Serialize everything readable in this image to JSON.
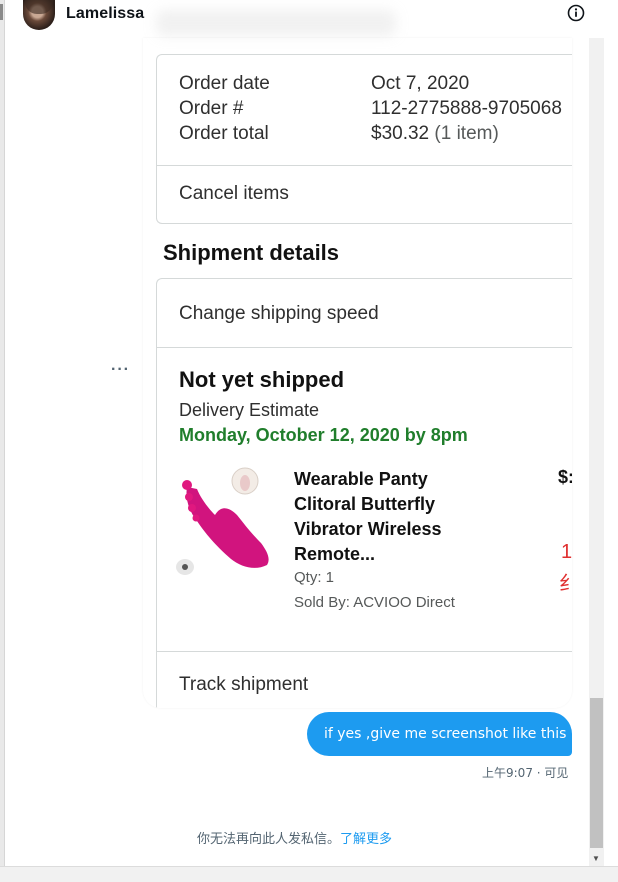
{
  "header": {
    "user_name": "Lamelissa",
    "info_icon": "info-icon"
  },
  "order_card": {
    "order_date_label": "Order date",
    "order_date_value": "Oct 7, 2020",
    "order_number_label": "Order #",
    "order_number_value": "112-2775888-9705068",
    "order_total_label": "Order total",
    "order_total_value": "$30.32",
    "order_total_items": "(1 item)",
    "cancel_items": "Cancel items"
  },
  "shipment": {
    "title": "Shipment details",
    "change_speed": "Change shipping speed",
    "status": "Not yet shipped",
    "delivery_label": "Delivery Estimate",
    "delivery_date": "Monday, October 12, 2020 by 8pm",
    "product_title_lines": [
      "Wearable Panty",
      "Clitoral Butterfly",
      "Vibrator Wireless",
      "Remote..."
    ],
    "qty": "Qty: 1",
    "sold_by": "Sold By: ACVIOO Direct",
    "price_cut": "$:",
    "red_line_1": "1",
    "red_line_2": "纟",
    "track_shipment": "Track shipment"
  },
  "more_options": "···",
  "message": {
    "text": "if yes ,give me screenshot like this",
    "meta": "上午9:07 · 可见"
  },
  "footer": {
    "text": "你无法再向此人发私信。",
    "link": "了解更多"
  },
  "colors": {
    "accent": "#1d9bf0",
    "green": "#207e2c",
    "red": "#e03030",
    "product_magenta": "#d1147e"
  }
}
